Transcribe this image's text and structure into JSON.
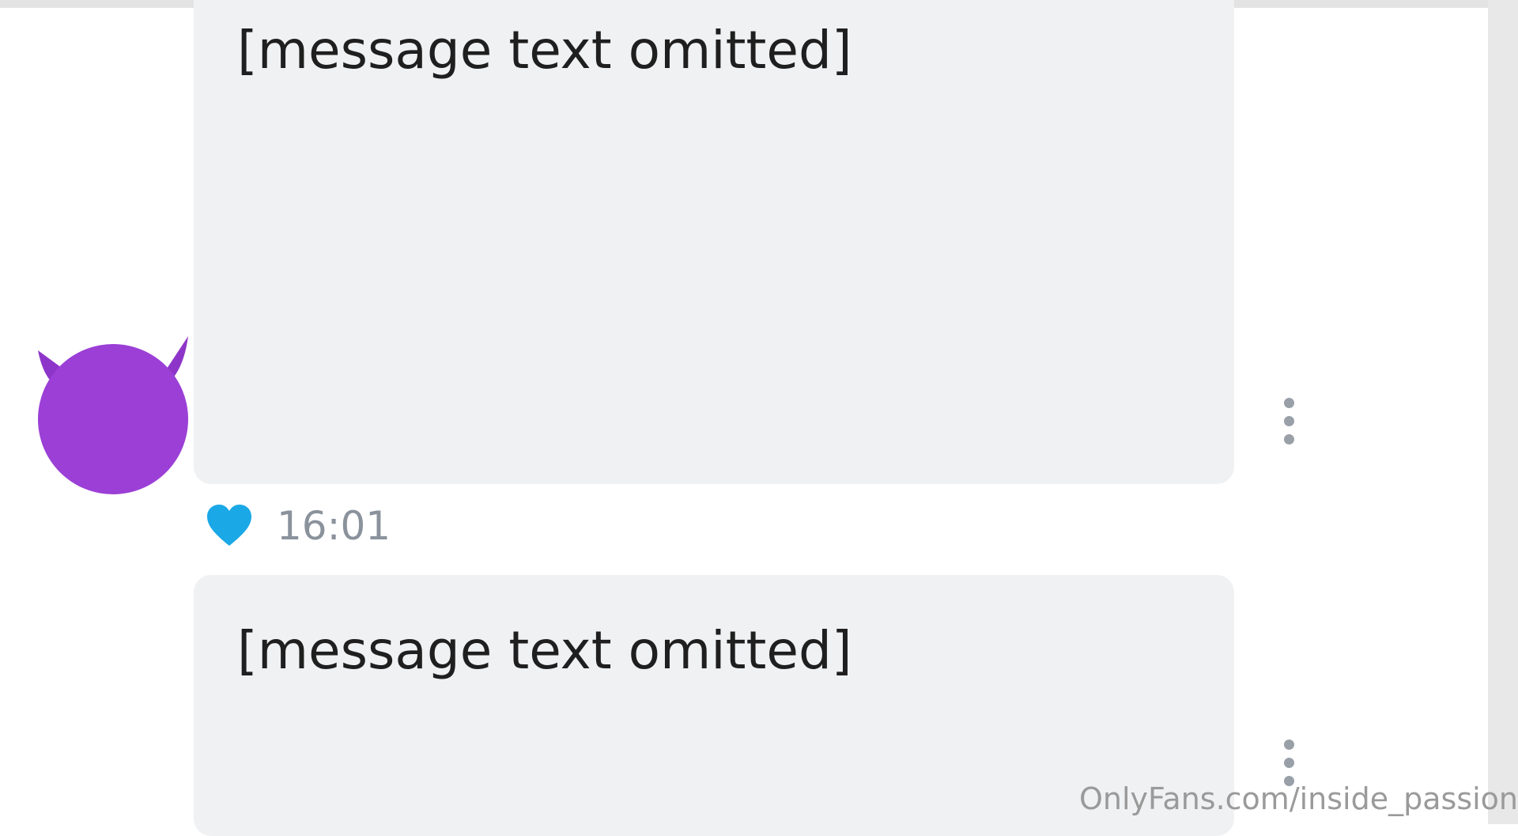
{
  "messages": [
    {
      "lines": [
        "[message text omitted]",
        "",
        "",
        "",
        ""
      ]
    },
    {
      "lines": [
        "[message text omitted]",
        ""
      ]
    }
  ],
  "meta": {
    "time": "16:01",
    "like_icon": "heart-icon",
    "like_color": "#1aa8e6"
  },
  "avatar": {
    "icon": "smiling-devil-icon",
    "color": "#9b3fd6"
  },
  "watermark": "OnlyFans.com/inside_passion"
}
